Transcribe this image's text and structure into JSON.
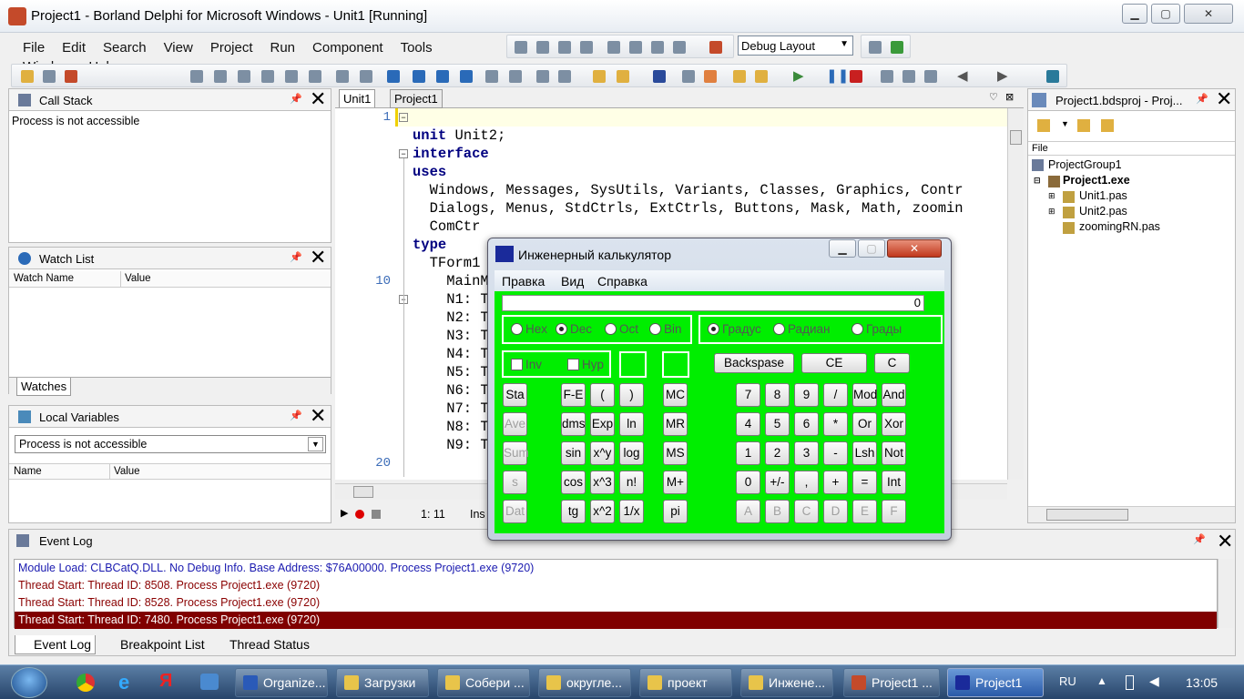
{
  "window": {
    "title": "Project1 - Borland Delphi for Microsoft Windows - Unit1 [Running]"
  },
  "menu": [
    "File",
    "Edit",
    "Search",
    "View",
    "Project",
    "Run",
    "Component",
    "Tools",
    "Window",
    "Help"
  ],
  "layout_combo": "Debug Layout",
  "call_stack": {
    "title": "Call Stack",
    "message": "Process is not accessible"
  },
  "watch_list": {
    "title": "Watch List",
    "cols": [
      "Watch Name",
      "Value"
    ],
    "tab": "Watches"
  },
  "local_vars": {
    "title": "Local Variables",
    "combo": "Process is not accessible",
    "cols": [
      "Name",
      "Value"
    ]
  },
  "editor": {
    "tabs": [
      "Unit1",
      "Project1"
    ],
    "status_pos": "1: 11",
    "status_mode": "Ins",
    "lines": [
      "unit Unit2;",
      "",
      "interface",
      "",
      "uses",
      "  Windows, Messages, SysUtils, Variants, Classes, Graphics, Contr",
      "  Dialogs, Menus, StdCtrls, ExtCtrls, Buttons, Mask, Math, zoomin",
      "  ComCtr",
      "",
      "type",
      "  TForm1",
      "    MainM",
      "    N1: T",
      "    N2: T",
      "    N3: T",
      "    N4: T",
      "    N5: T",
      "    N6: T",
      "    N7: T",
      "    N8: T",
      "    N9: T"
    ],
    "line_numbers": [
      "1",
      "10",
      "20"
    ]
  },
  "project": {
    "title": "Project1.bdsproj - Proj...",
    "col": "File",
    "group": "ProjectGroup1",
    "exe": "Project1.exe",
    "files": [
      "Unit1.pas",
      "Unit2.pas",
      "zoomingRN.pas"
    ]
  },
  "calc": {
    "title": "Инженерный калькулятор",
    "menu": [
      "Правка",
      "Вид",
      "Справка"
    ],
    "display": "0",
    "bases": [
      "Hex",
      "Dec",
      "Oct",
      "Bin"
    ],
    "angles": [
      "Градус",
      "Радиан",
      "Грады"
    ],
    "inv": "Inv",
    "hyp": "Hyp",
    "backspace": "Backspase",
    "ce": "CE",
    "c": "C",
    "col1": [
      "Sta",
      "Ave",
      "Sum",
      "s",
      "Dat"
    ],
    "fn": [
      "F-E",
      "(",
      ")",
      "dms",
      "Exp",
      "ln",
      "sin",
      "x^y",
      "log",
      "cos",
      "x^3",
      "n!",
      "tg",
      "x^2",
      "1/x"
    ],
    "mem": [
      "MC",
      "MR",
      "MS",
      "M+",
      "pi"
    ],
    "digits": [
      "7",
      "8",
      "9",
      "/",
      "Mod",
      "And",
      "4",
      "5",
      "6",
      "*",
      "Or",
      "Xor",
      "1",
      "2",
      "3",
      "-",
      "Lsh",
      "Not",
      "0",
      "+/-",
      ",",
      "+",
      "=",
      "Int",
      "A",
      "B",
      "C",
      "D",
      "E",
      "F"
    ]
  },
  "event_log": {
    "title": "Event Log",
    "entries": [
      "Module Load: CLBCatQ.DLL. No Debug Info. Base Address: $76A00000. Process Project1.exe (9720)",
      "Thread Start: Thread ID: 8508. Process Project1.exe (9720)",
      "Thread Start: Thread ID: 8528. Process Project1.exe (9720)",
      "Thread Start: Thread ID: 7480. Process Project1.exe (9720)"
    ],
    "tabs": [
      "Event Log",
      "Breakpoint List",
      "Thread Status"
    ]
  },
  "taskbar": {
    "items": [
      "Organize...",
      "Загрузки",
      "Собери ...",
      "округле...",
      "проект",
      "Инжене...",
      "Project1 ...",
      "Project1"
    ],
    "lang": "RU",
    "time": "13:05"
  }
}
